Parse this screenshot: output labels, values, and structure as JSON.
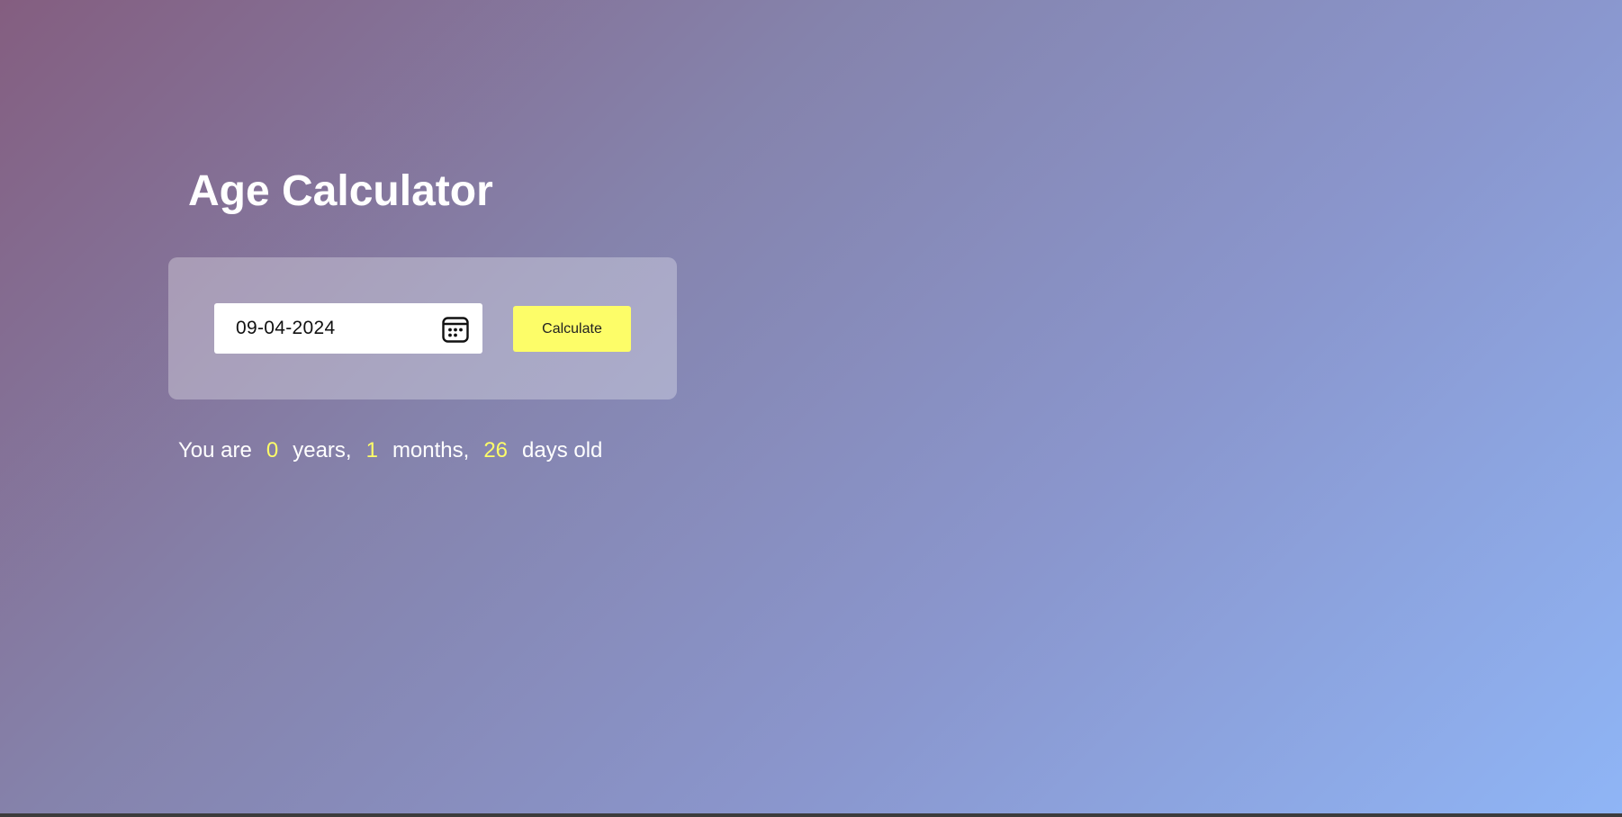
{
  "app": {
    "title": "Age Calculator"
  },
  "form": {
    "date_value": "09-04-2024",
    "calendar_icon": "calendar-icon",
    "calculate_label": "Calculate"
  },
  "result": {
    "prefix": "You are",
    "years": "0",
    "years_label": "years,",
    "months": "1",
    "months_label": "months,",
    "days": "26",
    "days_label": "days old"
  },
  "colors": {
    "accent": "#fdfd68",
    "gradient_start": "#845e80",
    "gradient_end": "#8fb5f6",
    "text": "#ffffff"
  }
}
